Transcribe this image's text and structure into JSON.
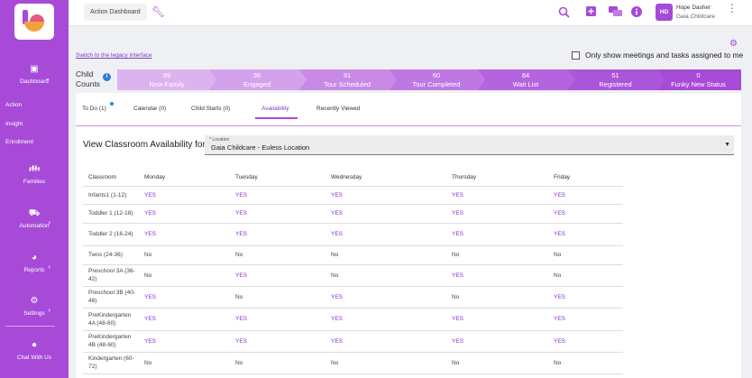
{
  "colors": {
    "brand": "#a74ad8",
    "yes": "#8a2fd0",
    "link": "#7b3fc4"
  },
  "sidebar": {
    "dashboard": "Dashboard",
    "links": [
      "Action",
      "Insight",
      "Enrollment"
    ],
    "families": "Families",
    "automation": "Automation",
    "reports": "Reports",
    "settings": "Settings",
    "chat": "Chat With Us"
  },
  "topbar": {
    "action_dashboard": "Action Dashboard",
    "avatar_initials": "HD",
    "user_name": "Hope Dasher",
    "user_org": "Gaia Childcare",
    "icons": [
      "search-icon",
      "add-icon",
      "chat-icon",
      "info-icon"
    ]
  },
  "legacy_link": "Switch to the legacy interface",
  "show_only_label": "Only show meetings and tasks assigned to me",
  "child_counts_label": {
    "line1": "Child",
    "line2": "Counts"
  },
  "stages": [
    {
      "count": "99",
      "name": "New Family",
      "color": "#dcb3ef"
    },
    {
      "count": "36",
      "name": "Engaged",
      "color": "#d3a2ec"
    },
    {
      "count": "91",
      "name": "Tour Scheduled",
      "color": "#c88ae6"
    },
    {
      "count": "60",
      "name": "Tour Completed",
      "color": "#bf78e3"
    },
    {
      "count": "84",
      "name": "Wait List",
      "color": "#b464de"
    },
    {
      "count": "51",
      "name": "Registered",
      "color": "#ab55da"
    },
    {
      "count": "0",
      "name": "Funky New Status",
      "color": "#a74ad8"
    }
  ],
  "tabs": [
    "To Do (1)",
    "Calendar (0)",
    "Child Starts (0)",
    "Availability",
    "Recently Viewed"
  ],
  "availability": {
    "title": "View Classroom Availability for",
    "location_label": "* Location",
    "location_value": "Gaia Childcare - Euless Location",
    "columns": [
      "Classroom",
      "Monday",
      "Tuesday",
      "Wednesday",
      "Thursday",
      "Friday"
    ],
    "rows": [
      {
        "classroom": "Infants1 (1-12)",
        "days": [
          "YES",
          "YES",
          "YES",
          "YES",
          "YES"
        ]
      },
      {
        "classroom": "Toddler 1 (12-18)",
        "days": [
          "YES",
          "YES",
          "YES",
          "YES",
          "YES"
        ]
      },
      {
        "classroom": "Toddler 2 (16-24)",
        "days": [
          "YES",
          "YES",
          "YES",
          "YES",
          "YES"
        ]
      },
      {
        "classroom": "Twos (24-36)",
        "days": [
          "No",
          "No",
          "No",
          "No",
          "No"
        ]
      },
      {
        "classroom": "Preschool 3A (36-42)",
        "days": [
          "No",
          "YES",
          "No",
          "YES",
          "No"
        ]
      },
      {
        "classroom": "Preschool 3B (40-48)",
        "days": [
          "YES",
          "No",
          "YES",
          "No",
          "YES"
        ]
      },
      {
        "classroom": "PreKindergarten 4A (48-60)",
        "days": [
          "YES",
          "YES",
          "YES",
          "YES",
          "YES"
        ]
      },
      {
        "classroom": "PreKindergarten 4B (48-60)",
        "days": [
          "YES",
          "YES",
          "YES",
          "YES",
          "YES"
        ]
      },
      {
        "classroom": "Kindergarten (60-72)",
        "days": [
          "No",
          "No",
          "No",
          "No",
          "No"
        ]
      }
    ]
  }
}
